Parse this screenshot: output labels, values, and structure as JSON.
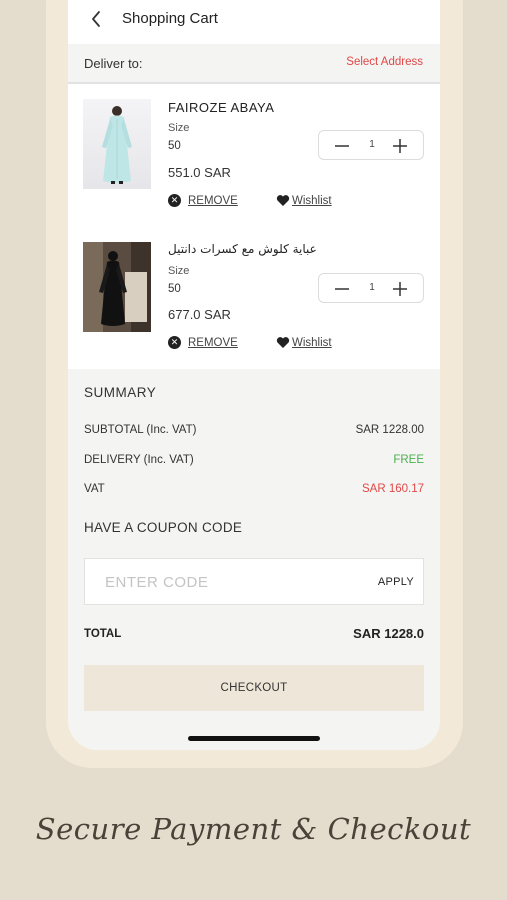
{
  "header": {
    "title": "Shopping Cart",
    "back_icon": "chevron-left-icon"
  },
  "delivery": {
    "label": "Deliver to:",
    "select_address": "Select Address"
  },
  "cart_items": [
    {
      "name": "FAIROZE ABAYA",
      "size_label": "Size",
      "size": "50",
      "price": "551.0 SAR",
      "quantity": "1",
      "remove_label": "REMOVE",
      "wishlist_label": "Wishlist"
    },
    {
      "name": "عباية كلوش مع كسرات دانتيل",
      "size_label": "Size",
      "size": "50",
      "price": "677.0 SAR",
      "quantity": "1",
      "remove_label": "REMOVE",
      "wishlist_label": "Wishlist"
    }
  ],
  "summary": {
    "title": "SUMMARY",
    "rows": [
      {
        "label": "SUBTOTAL (Inc. VAT)",
        "value": "SAR 1228.00",
        "color": "#333333"
      },
      {
        "label": "DELIVERY (Inc. VAT)",
        "value": "FREE",
        "color": "#4caf50"
      },
      {
        "label": "VAT",
        "value": "SAR 160.17",
        "color": "#e04848"
      }
    ],
    "coupon_title": "HAVE A COUPON CODE",
    "coupon_placeholder": "ENTER CODE",
    "apply_label": "APPLY",
    "total_label": "TOTAL",
    "total_value": "SAR 1228.0",
    "checkout_label": "CHECKOUT"
  },
  "caption": "Secure Payment & Checkout",
  "colors": {
    "background": "#e4dccc",
    "frame": "#f3e9d8",
    "accent_red": "#e04848",
    "free_green": "#4caf50",
    "checkout_bg": "#eee6d8"
  }
}
